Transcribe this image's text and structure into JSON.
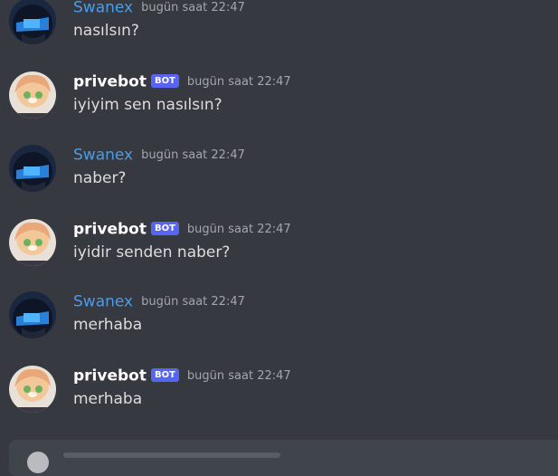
{
  "messages": [
    {
      "author": "Swanex",
      "is_bot": false,
      "timestamp": "bugün saat 22:47",
      "text": "nasılsın?"
    },
    {
      "author": "privebot",
      "is_bot": true,
      "badge": "BOT",
      "timestamp": "bugün saat 22:47",
      "text": "iyiyim sen nasılsın?"
    },
    {
      "author": "Swanex",
      "is_bot": false,
      "timestamp": "bugün saat 22:47",
      "text": "naber?"
    },
    {
      "author": "privebot",
      "is_bot": true,
      "badge": "BOT",
      "timestamp": "bugün saat 22:47",
      "text": "iyidir senden naber?"
    },
    {
      "author": "Swanex",
      "is_bot": false,
      "timestamp": "bugün saat 22:47",
      "text": "merhaba"
    },
    {
      "author": "privebot",
      "is_bot": true,
      "badge": "BOT",
      "timestamp": "bugün saat 22:47",
      "text": "merhaba"
    }
  ],
  "colors": {
    "background": "#36393f",
    "human_username": "#4a9ce9",
    "bot_username": "#ffffff",
    "bot_badge": "#5865f2",
    "timestamp": "#a3a6aa",
    "message_text": "#dcddde"
  },
  "icons": {
    "human_avatar": "swanex-avatar-icon",
    "bot_avatar": "privebot-avatar-icon",
    "composer": "add-attachment-icon"
  }
}
